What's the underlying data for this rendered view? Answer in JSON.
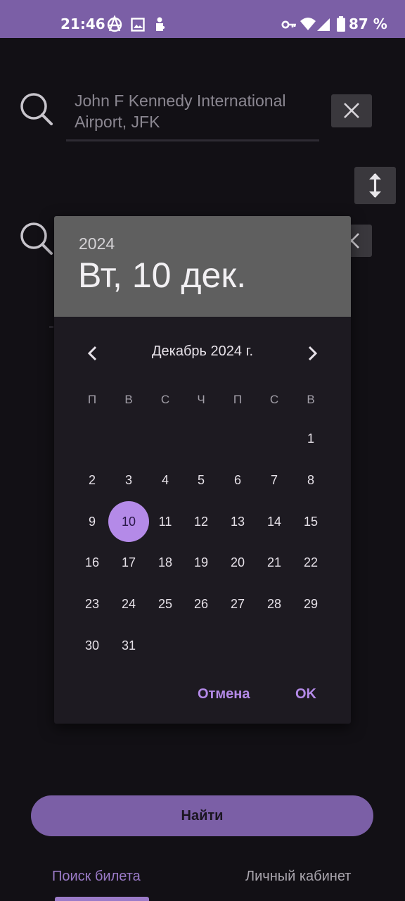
{
  "status_bar": {
    "time": "21:46",
    "battery": "87 %",
    "icons": [
      "anarchy-icon",
      "image-icon",
      "puzzle-icon",
      "key-icon",
      "wifi-icon",
      "signal-icon",
      "battery-icon"
    ]
  },
  "search": {
    "from_value": "John F Kennedy International Airport, JFK"
  },
  "dialog": {
    "year": "2024",
    "selected_date": "Вт, 10 дек.",
    "month_title": "Декабрь 2024 г.",
    "weekdays": [
      "П",
      "В",
      "С",
      "Ч",
      "П",
      "С",
      "В"
    ],
    "days": [
      "1",
      "2",
      "3",
      "4",
      "5",
      "6",
      "7",
      "8",
      "9",
      "10",
      "11",
      "12",
      "13",
      "14",
      "15",
      "16",
      "17",
      "18",
      "19",
      "20",
      "21",
      "22",
      "23",
      "24",
      "25",
      "26",
      "27",
      "28",
      "29",
      "30",
      "31"
    ],
    "selected_day": "10",
    "cancel_label": "Отмена",
    "ok_label": "OK"
  },
  "find_button_label": "Найти",
  "tabs": {
    "search_label": "Поиск билета",
    "account_label": "Личный кабинет"
  },
  "colors": {
    "accent": "#7b5fa6",
    "selected_day": "#b48ae8",
    "background": "#121015"
  }
}
